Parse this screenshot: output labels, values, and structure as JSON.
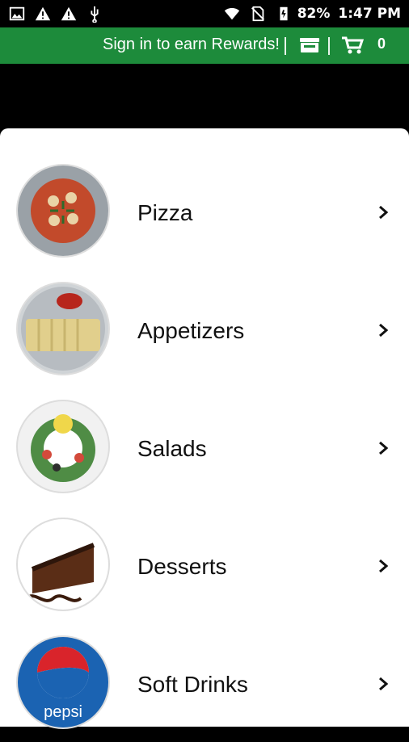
{
  "status_bar": {
    "left_icons": [
      "image-icon",
      "warning-icon",
      "warning-icon",
      "usb-icon"
    ],
    "right_icons": [
      "wifi-icon",
      "no-sim-icon",
      "battery-icon"
    ],
    "battery_percent": "82%",
    "time": "1:47 PM"
  },
  "top_bar": {
    "signin_text": "Sign in to earn Rewards!",
    "cart_count": "0",
    "accent": "#1d8b3b"
  },
  "menu": {
    "items": [
      {
        "label": "Pizza",
        "icon": "pizza-thumbnail"
      },
      {
        "label": "Appetizers",
        "icon": "appetizers-thumbnail"
      },
      {
        "label": "Salads",
        "icon": "salad-thumbnail"
      },
      {
        "label": "Desserts",
        "icon": "dessert-thumbnail"
      },
      {
        "label": "Soft Drinks",
        "icon": "pepsi-logo",
        "logo_text": "pepsi"
      }
    ]
  }
}
